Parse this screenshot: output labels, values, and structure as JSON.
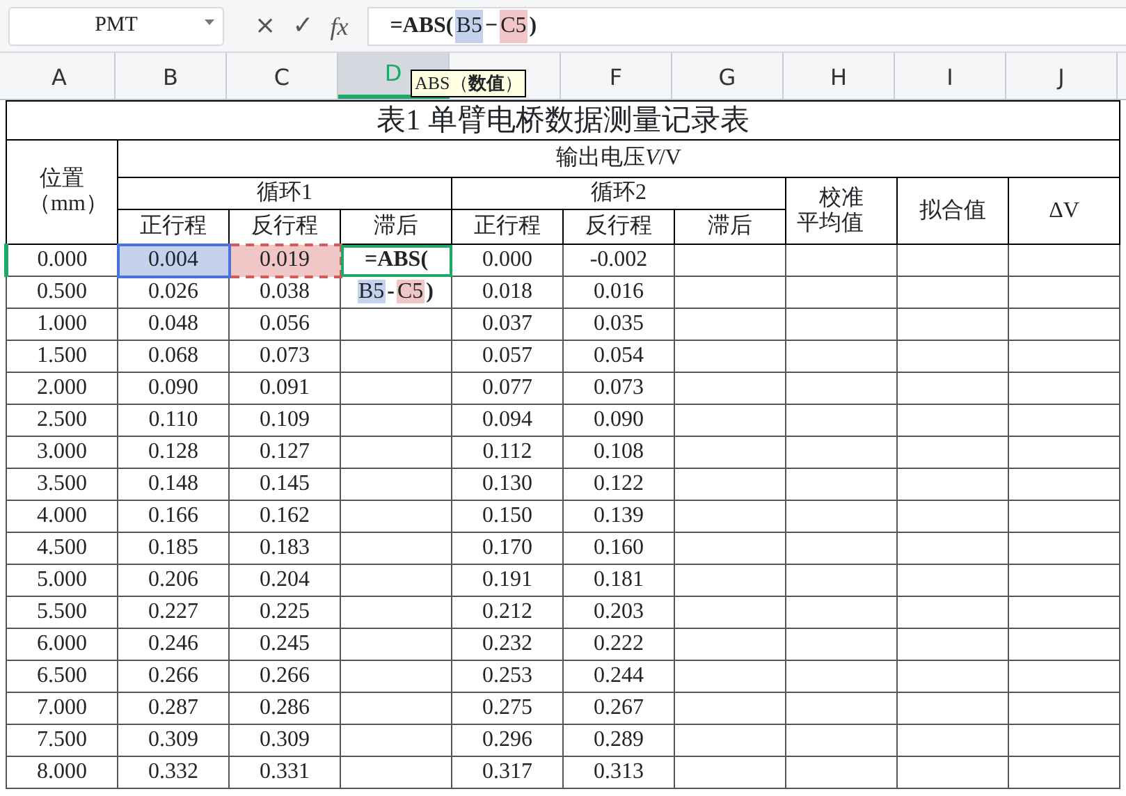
{
  "formula_bar": {
    "name_box": "PMT",
    "cancel": "×",
    "confirm": "✓",
    "fx": "fx",
    "tokens": [
      {
        "text": "=ABS("
      },
      {
        "text": "B5",
        "color": "#c5d2ee"
      },
      {
        "text": "−"
      },
      {
        "text": "C5",
        "color": "#f0c6c6"
      },
      {
        "text": ")"
      }
    ]
  },
  "tooltip": "ABS（**数值**）",
  "columns": [
    {
      "label": "A",
      "selected": false
    },
    {
      "label": "B",
      "selected": false
    },
    {
      "label": "C",
      "selected": false
    },
    {
      "label": "D",
      "selected": true
    },
    {
      "selected": false
    },
    {
      "label": "F",
      "selected": false
    },
    {
      "label": "G",
      "selected": false
    },
    {
      "label": "H",
      "selected": false
    },
    {
      "label": "I",
      "selected": false
    },
    {
      "label": "J",
      "selected": false
    }
  ],
  "sheet": {
    "title": "表1  单臂电桥数据测量记录表",
    "position_header": "位置（mm）",
    "output_header": "输出电压",
    "output_symbol": "V",
    "output_unit": "/V",
    "cycles": [
      {
        "label": "循环1",
        "forward": "正行程",
        "reverse": "反行程",
        "hysteresis": "滞后"
      },
      {
        "label": "循环2",
        "forward": "正行程",
        "reverse": "反行程",
        "hysteresis": "滞后"
      }
    ],
    "extra_headers": [
      "校准平均值",
      "拟合值",
      "ΔV"
    ],
    "editor": {
      "lines": [
        [
          {
            "text": "=ABS("
          }
        ],
        [
          {
            "text": "B5",
            "color": "#c5d2ee"
          },
          {
            "text": "-"
          },
          {
            "text": "C5",
            "color": "#f0c6c6"
          },
          {
            "text": ")"
          }
        ]
      ]
    },
    "rows": [
      {
        "values": [
          "0.000",
          "0.004",
          "0.019",
          "0.000",
          "-0.002"
        ],
        "highlighted": true,
        "active": true
      },
      {
        "values": [
          "0.500",
          "0.026",
          "0.038",
          "0.018",
          "0.016"
        ],
        "active": false
      },
      {
        "values": [
          "1.000",
          "0.048",
          "0.056",
          "0.037",
          "0.035"
        ],
        "active": false
      },
      {
        "values": [
          "1.500",
          "0.068",
          "0.073",
          "0.057",
          "0.054"
        ],
        "active": false
      },
      {
        "values": [
          "2.000",
          "0.090",
          "0.091",
          "0.077",
          "0.073"
        ],
        "active": false
      },
      {
        "values": [
          "2.500",
          "0.110",
          "0.109",
          "0.094",
          "0.090"
        ],
        "active": false
      },
      {
        "values": [
          "3.000",
          "0.128",
          "0.127",
          "0.112",
          "0.108"
        ],
        "active": false
      },
      {
        "values": [
          "3.500",
          "0.148",
          "0.145",
          "0.130",
          "0.122"
        ],
        "active": false
      },
      {
        "values": [
          "4.000",
          "0.166",
          "0.162",
          "0.150",
          "0.139"
        ],
        "active": false
      },
      {
        "values": [
          "4.500",
          "0.185",
          "0.183",
          "0.170",
          "0.160"
        ],
        "active": false
      },
      {
        "values": [
          "5.000",
          "0.206",
          "0.204",
          "0.191",
          "0.181"
        ],
        "active": false
      },
      {
        "values": [
          "5.500",
          "0.227",
          "0.225",
          "0.212",
          "0.203"
        ],
        "active": false
      },
      {
        "values": [
          "6.000",
          "0.246",
          "0.245",
          "0.232",
          "0.222"
        ],
        "active": false
      },
      {
        "values": [
          "6.500",
          "0.266",
          "0.266",
          "0.253",
          "0.244"
        ],
        "active": false
      },
      {
        "values": [
          "7.000",
          "0.287",
          "0.286",
          "0.275",
          "0.267"
        ],
        "active": false
      },
      {
        "values": [
          "7.500",
          "0.309",
          "0.309",
          "0.296",
          "0.289"
        ],
        "active": false
      },
      {
        "values": [
          "8.000",
          "0.332",
          "0.331",
          "0.317",
          "0.313"
        ],
        "active": false
      }
    ]
  }
}
